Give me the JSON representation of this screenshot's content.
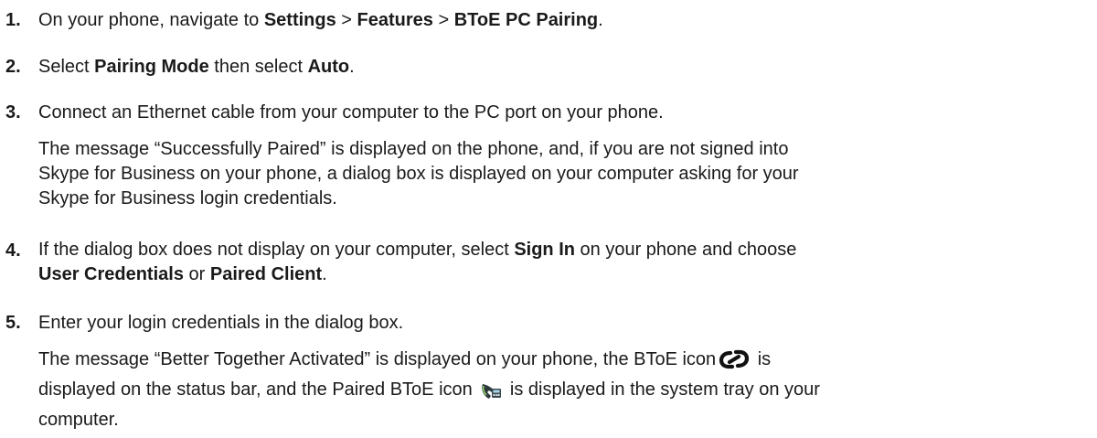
{
  "steps": [
    {
      "number": "1.",
      "pre": "On your phone, navigate to ",
      "b1": "Settings",
      "sep1": " > ",
      "b2": "Features",
      "sep2": " > ",
      "b3": "BToE PC Pairing",
      "post": "."
    },
    {
      "number": "2.",
      "pre": "Select ",
      "b1": "Pairing Mode",
      "mid": " then select ",
      "b2": "Auto",
      "post": "."
    },
    {
      "number": "3.",
      "text": "Connect an Ethernet cable from your computer to the PC port on your phone.",
      "note_lines": [
        "The message “Successfully Paired” is displayed on the phone, and, if you are not signed into",
        "Skype for Business on your phone, a dialog box is displayed on your computer asking for your",
        "Skype for Business login credentials."
      ]
    },
    {
      "number": "4.",
      "pre": "If the dialog box does not display on your computer, select ",
      "b1": "Sign In",
      "mid": " on your phone and choose",
      "b2": "User Credentials",
      "mid2": " or ",
      "b3": "Paired Client",
      "post": "."
    },
    {
      "number": "5.",
      "text": "Enter your login credentials in the dialog box.",
      "note_line1_pre": "The message “Better Together Activated” is displayed on your phone, the BToE icon",
      "note_line1_post": " is",
      "note_line2_pre": "displayed on the status bar, and the Paired BToE icon",
      "note_line2_post": " is displayed in the system tray on your",
      "note_line3": "computer."
    }
  ],
  "icons": {
    "btoe_icon": "btoe-link-icon",
    "paired_btoe_icon": "paired-btoe-tray-icon"
  }
}
